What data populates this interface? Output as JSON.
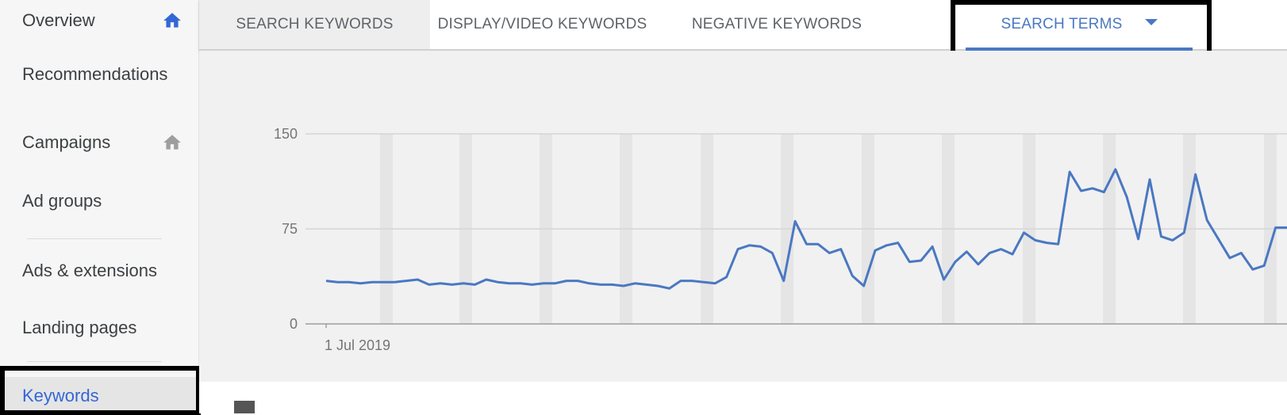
{
  "sidebar": {
    "items": [
      {
        "label": "Overview",
        "icon": "home-icon",
        "icon_color": "#3367d6"
      },
      {
        "label": "Recommendations"
      },
      {
        "label": "Campaigns",
        "icon": "home-icon",
        "icon_color": "#9e9e9e"
      },
      {
        "label": "Ad groups"
      },
      {
        "label": "Ads & extensions"
      },
      {
        "label": "Landing pages"
      },
      {
        "label": "Keywords",
        "active": true
      }
    ]
  },
  "tabs": [
    {
      "label": "SEARCH KEYWORDS"
    },
    {
      "label": "DISPLAY/VIDEO KEYWORDS"
    },
    {
      "label": "NEGATIVE KEYWORDS"
    },
    {
      "label": "SEARCH TERMS",
      "active": true,
      "has_dropdown": true
    }
  ],
  "colors": {
    "accent": "#4a78c2",
    "line": "#4a78c2",
    "highlight_box": "#000000"
  },
  "chart_data": {
    "type": "line",
    "x_start_label": "1 Jul 2019",
    "yticks": [
      0,
      75,
      150
    ],
    "ylim": [
      0,
      150
    ],
    "series": [
      {
        "values": [
          34,
          33,
          33,
          32,
          33,
          33,
          33,
          34,
          35,
          31,
          32,
          31,
          32,
          31,
          35,
          33,
          32,
          32,
          31,
          32,
          32,
          34,
          34,
          32,
          31,
          31,
          30,
          32,
          31,
          30,
          28,
          34,
          34,
          33,
          32,
          37,
          59,
          62,
          61,
          56,
          34,
          81,
          63,
          63,
          56,
          59,
          38,
          30,
          58,
          62,
          64,
          49,
          50,
          61,
          35,
          49,
          57,
          47,
          56,
          59,
          55,
          72,
          66,
          64,
          63,
          120,
          105,
          107,
          104,
          122,
          100,
          67,
          114,
          69,
          66,
          72,
          118,
          82,
          67,
          52,
          56,
          43,
          46,
          76,
          76
        ]
      }
    ]
  }
}
